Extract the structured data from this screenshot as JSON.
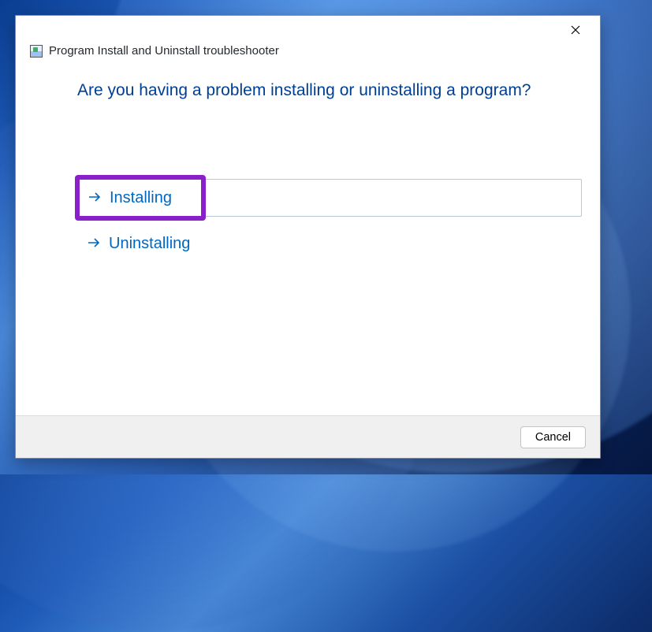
{
  "window": {
    "title": "Program Install and Uninstall troubleshooter"
  },
  "content": {
    "heading": "Are you having a problem installing or uninstalling a program?",
    "options": [
      {
        "label": "Installing",
        "selected": true,
        "highlighted": true
      },
      {
        "label": "Uninstalling",
        "selected": false,
        "highlighted": false
      }
    ]
  },
  "footer": {
    "cancel_label": "Cancel"
  },
  "annotation": {
    "highlight_color": "#8a20c9"
  }
}
